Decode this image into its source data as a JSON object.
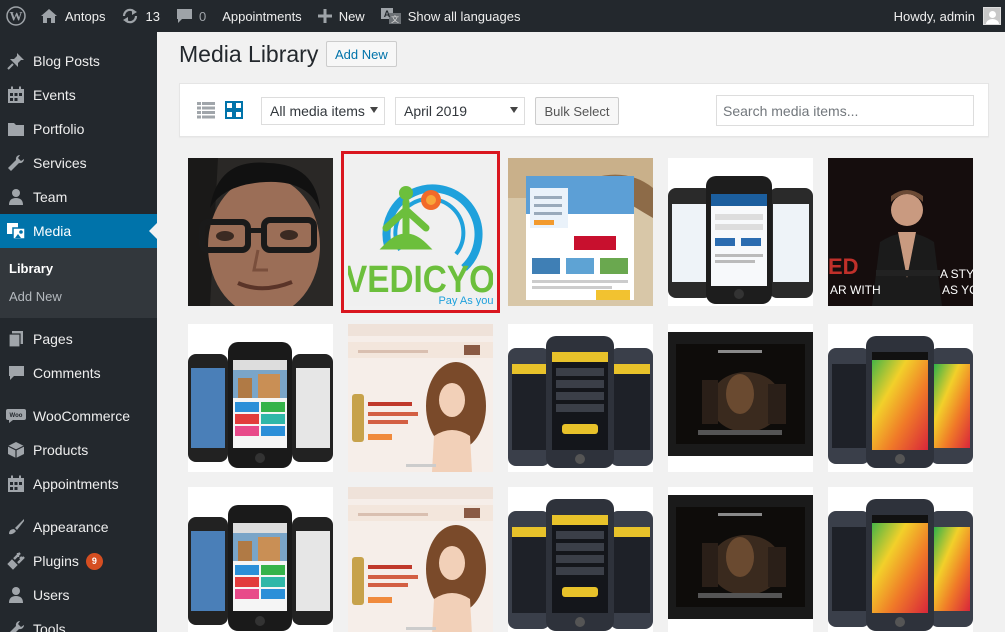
{
  "adminbar": {
    "site_name": "Antops",
    "updates_count": "13",
    "comments_count": "0",
    "appointments_label": "Appointments",
    "new_label": "New",
    "languages_label": "Show all languages",
    "howdy": "Howdy, admin"
  },
  "sidebar": {
    "items": [
      {
        "label": "Blog Posts",
        "icon": "pushpin-icon"
      },
      {
        "label": "Events",
        "icon": "calendar-icon"
      },
      {
        "label": "Portfolio",
        "icon": "folder-icon"
      },
      {
        "label": "Services",
        "icon": "wrench-icon"
      },
      {
        "label": "Team",
        "icon": "person-icon"
      },
      {
        "label": "Media",
        "icon": "media-icon",
        "current": true
      },
      {
        "label": "Pages",
        "icon": "page-icon"
      },
      {
        "label": "Comments",
        "icon": "comment-icon"
      },
      {
        "label": "WooCommerce",
        "icon": "woo-icon"
      },
      {
        "label": "Products",
        "icon": "box-icon"
      },
      {
        "label": "Appointments",
        "icon": "calendar-icon"
      },
      {
        "label": "Appearance",
        "icon": "brush-icon"
      },
      {
        "label": "Plugins",
        "icon": "plug-icon",
        "badge": "9"
      },
      {
        "label": "Users",
        "icon": "users-icon"
      },
      {
        "label": "Tools",
        "icon": "tools-icon"
      }
    ],
    "media_submenu": [
      {
        "label": "Library",
        "active": true
      },
      {
        "label": "Add New"
      }
    ]
  },
  "main": {
    "title": "Media Library",
    "add_new_label": "Add New",
    "filter_media": "All media items",
    "filter_date": "April 2019",
    "bulk_select_label": "Bulk Select",
    "search_placeholder": "Search media items..."
  },
  "grid": {
    "columns": 5,
    "rows": 3,
    "tiles": [
      {
        "name": "portrait-man"
      },
      {
        "name": "vedicyog-logo",
        "selected": true
      },
      {
        "name": "travel-website"
      },
      {
        "name": "iphone-app-login"
      },
      {
        "name": "martial-arts-banner"
      },
      {
        "name": "iphone-app-apartments"
      },
      {
        "name": "salon-website"
      },
      {
        "name": "iphone-app-dark"
      },
      {
        "name": "ipad-luxury"
      },
      {
        "name": "iphone-app-colorful"
      },
      {
        "name": "iphone-app-apartments"
      },
      {
        "name": "salon-website"
      },
      {
        "name": "iphone-app-dark"
      },
      {
        "name": "ipad-luxury"
      },
      {
        "name": "iphone-app-colorful"
      }
    ]
  },
  "logo_text": {
    "vedicyog_main": "VEDICYO",
    "vedicyog_sub": "Pay As you"
  },
  "banner_text": {
    "line1": "ED",
    "line2": "A STY",
    "line3": "AR WITH",
    "line4": "AS YO"
  },
  "colors": {
    "admin_bar": "#23282d",
    "accent": "#0073aa",
    "badge": "#d54e21",
    "selection_outline": "#d9161f"
  }
}
